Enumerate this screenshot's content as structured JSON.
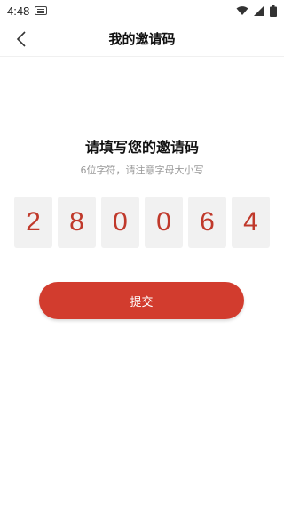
{
  "status_bar": {
    "time": "4:48"
  },
  "header": {
    "title": "我的邀请码"
  },
  "main": {
    "heading": "请填写您的邀请码",
    "hint": "6位字符，请注意字母大小写",
    "code": [
      "2",
      "8",
      "0",
      "0",
      "6",
      "4"
    ],
    "submit_label": "提交"
  },
  "colors": {
    "accent": "#d23c2e",
    "code_text": "#c0392b",
    "box_bg": "#f1f1f1"
  }
}
